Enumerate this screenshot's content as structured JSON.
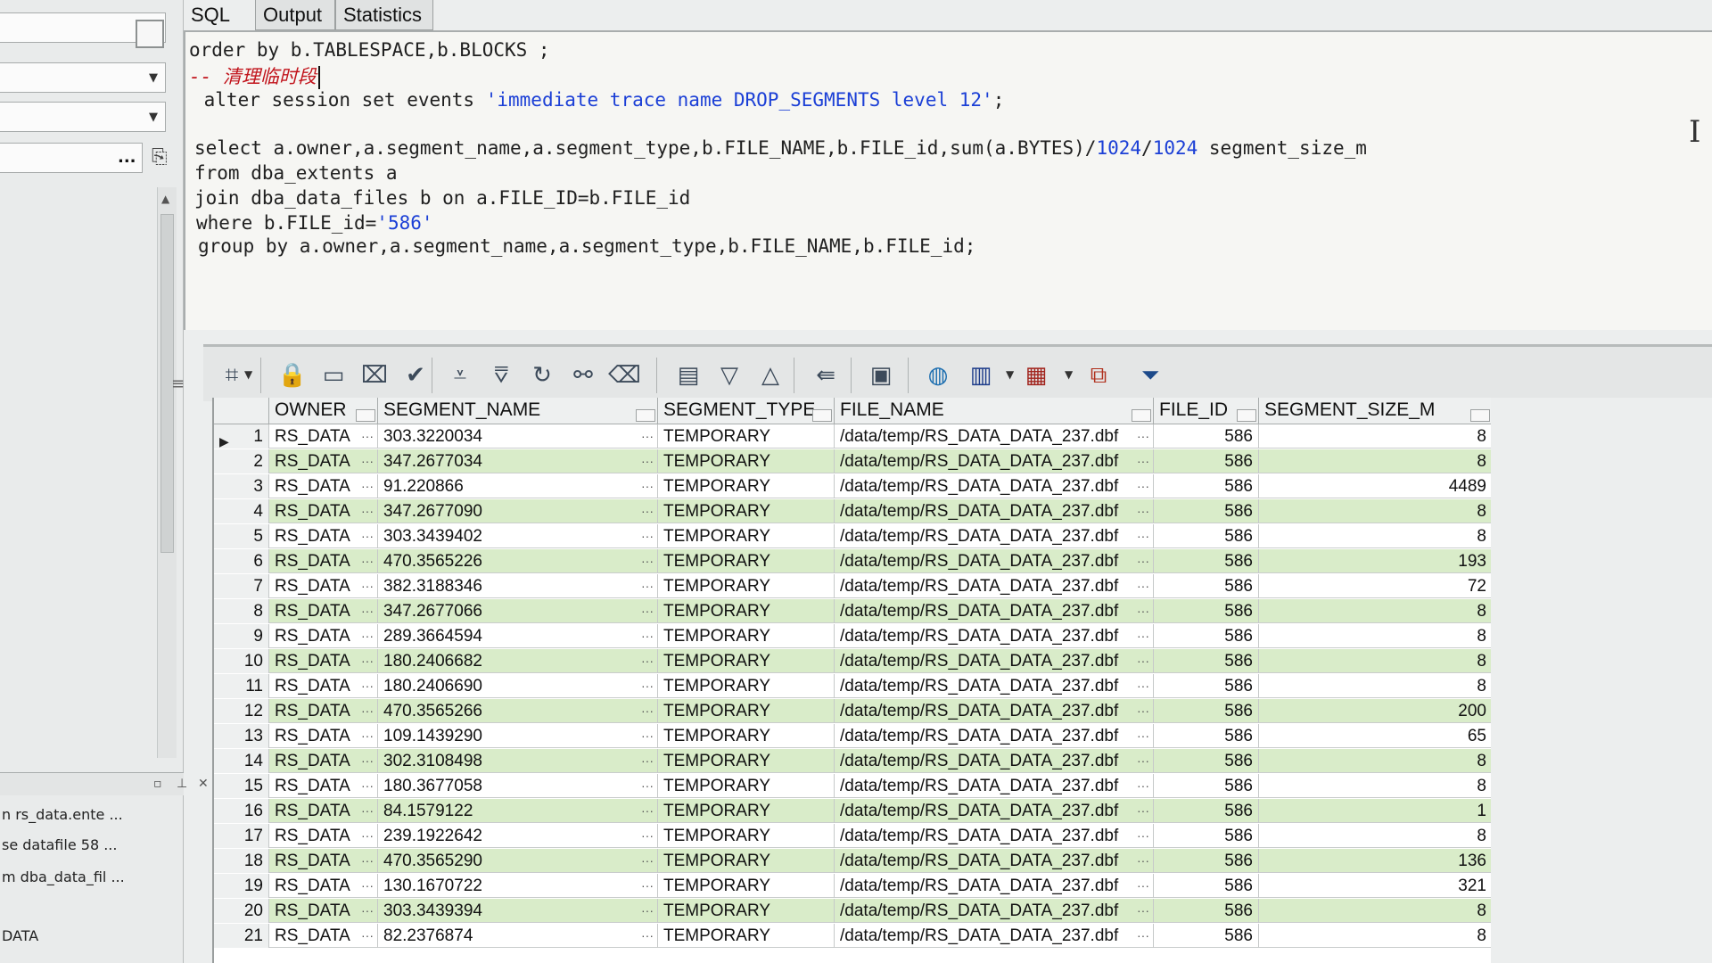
{
  "tabs": [
    {
      "label": "SQL"
    },
    {
      "label": "Output"
    },
    {
      "label": "Statistics"
    }
  ],
  "editor": {
    "lines": [
      [
        {
          "t": "order by b.TABLESPACE,b.BLOCKS ;",
          "c": ""
        }
      ],
      [
        {
          "t": "-- 清理临时段",
          "c": "comment"
        }
      ],
      [
        {
          "t": " alter session set events ",
          "c": ""
        },
        {
          "t": "'immediate trace name DROP_SEGMENTS level 12'",
          "c": "str"
        },
        {
          "t": ";",
          "c": ""
        }
      ],
      [
        {
          "t": "",
          "c": ""
        }
      ],
      [
        {
          "t": "select a.owner,a.segment_name,a.segment_type,b.FILE_NAME,b.FILE_id,sum(a.BYTES)/",
          "c": ""
        },
        {
          "t": "1024",
          "c": "num"
        },
        {
          "t": "/",
          "c": ""
        },
        {
          "t": "1024",
          "c": "num"
        },
        {
          "t": " segment_size_m",
          "c": ""
        }
      ],
      [
        {
          "t": "from dba_extents a",
          "c": ""
        }
      ],
      [
        {
          "t": "join dba_data_files b on a.FILE_ID=b.FILE_id",
          "c": ""
        }
      ],
      [
        {
          "t": "where b.FILE_id=",
          "c": ""
        },
        {
          "t": "'586'",
          "c": "str"
        }
      ],
      [
        {
          "t": "group by a.owner,a.segment_name,a.segment_type,b.FILE_NAME,b.FILE_id;",
          "c": ""
        }
      ]
    ]
  },
  "left_panel": {
    "items": [
      {
        "label": "n rs_data.ente ..."
      },
      {
        "label": "se datafile 58 ..."
      },
      {
        "label": "m dba_data_fil ..."
      },
      {
        "label": "DATA"
      }
    ],
    "ellipsis": "..."
  },
  "toolbar": {
    "icons": [
      "grid-select-icon",
      "lock-icon",
      "new-record-icon",
      "delete-record-icon",
      "post-check-icon",
      "fetch-next-icon",
      "fetch-last-icon",
      "refresh-icon",
      "find-binoculars-icon",
      "clear-eraser-icon",
      "single-record-view-icon",
      "arrow-down-icon",
      "arrow-up-icon",
      "export-query-icon",
      "save-disk-icon",
      "connect-globe-icon",
      "bar-chart-icon",
      "table-grid-icon",
      "compare-icon",
      "filter-funnel-icon"
    ]
  },
  "grid": {
    "columns": [
      {
        "label": ""
      },
      {
        "label": "OWNER"
      },
      {
        "label": "SEGMENT_NAME"
      },
      {
        "label": "SEGMENT_TYPE"
      },
      {
        "label": "FILE_NAME"
      },
      {
        "label": "FILE_ID"
      },
      {
        "label": "SEGMENT_SIZE_M"
      }
    ],
    "more_glyph": "···",
    "current_row_glyph": "▶",
    "rows": [
      {
        "no": "1",
        "owner": "RS_DATA",
        "segment_name": "303.3220034",
        "segment_type": "TEMPORARY",
        "file_name": "/data/temp/RS_DATA_DATA_237.dbf",
        "file_id": "586",
        "size": "8"
      },
      {
        "no": "2",
        "owner": "RS_DATA",
        "segment_name": "347.2677034",
        "segment_type": "TEMPORARY",
        "file_name": "/data/temp/RS_DATA_DATA_237.dbf",
        "file_id": "586",
        "size": "8"
      },
      {
        "no": "3",
        "owner": "RS_DATA",
        "segment_name": "91.220866",
        "segment_type": "TEMPORARY",
        "file_name": "/data/temp/RS_DATA_DATA_237.dbf",
        "file_id": "586",
        "size": "4489"
      },
      {
        "no": "4",
        "owner": "RS_DATA",
        "segment_name": "347.2677090",
        "segment_type": "TEMPORARY",
        "file_name": "/data/temp/RS_DATA_DATA_237.dbf",
        "file_id": "586",
        "size": "8"
      },
      {
        "no": "5",
        "owner": "RS_DATA",
        "segment_name": "303.3439402",
        "segment_type": "TEMPORARY",
        "file_name": "/data/temp/RS_DATA_DATA_237.dbf",
        "file_id": "586",
        "size": "8"
      },
      {
        "no": "6",
        "owner": "RS_DATA",
        "segment_name": "470.3565226",
        "segment_type": "TEMPORARY",
        "file_name": "/data/temp/RS_DATA_DATA_237.dbf",
        "file_id": "586",
        "size": "193"
      },
      {
        "no": "7",
        "owner": "RS_DATA",
        "segment_name": "382.3188346",
        "segment_type": "TEMPORARY",
        "file_name": "/data/temp/RS_DATA_DATA_237.dbf",
        "file_id": "586",
        "size": "72"
      },
      {
        "no": "8",
        "owner": "RS_DATA",
        "segment_name": "347.2677066",
        "segment_type": "TEMPORARY",
        "file_name": "/data/temp/RS_DATA_DATA_237.dbf",
        "file_id": "586",
        "size": "8"
      },
      {
        "no": "9",
        "owner": "RS_DATA",
        "segment_name": "289.3664594",
        "segment_type": "TEMPORARY",
        "file_name": "/data/temp/RS_DATA_DATA_237.dbf",
        "file_id": "586",
        "size": "8"
      },
      {
        "no": "10",
        "owner": "RS_DATA",
        "segment_name": "180.2406682",
        "segment_type": "TEMPORARY",
        "file_name": "/data/temp/RS_DATA_DATA_237.dbf",
        "file_id": "586",
        "size": "8"
      },
      {
        "no": "11",
        "owner": "RS_DATA",
        "segment_name": "180.2406690",
        "segment_type": "TEMPORARY",
        "file_name": "/data/temp/RS_DATA_DATA_237.dbf",
        "file_id": "586",
        "size": "8"
      },
      {
        "no": "12",
        "owner": "RS_DATA",
        "segment_name": "470.3565266",
        "segment_type": "TEMPORARY",
        "file_name": "/data/temp/RS_DATA_DATA_237.dbf",
        "file_id": "586",
        "size": "200"
      },
      {
        "no": "13",
        "owner": "RS_DATA",
        "segment_name": "109.1439290",
        "segment_type": "TEMPORARY",
        "file_name": "/data/temp/RS_DATA_DATA_237.dbf",
        "file_id": "586",
        "size": "65"
      },
      {
        "no": "14",
        "owner": "RS_DATA",
        "segment_name": "302.3108498",
        "segment_type": "TEMPORARY",
        "file_name": "/data/temp/RS_DATA_DATA_237.dbf",
        "file_id": "586",
        "size": "8"
      },
      {
        "no": "15",
        "owner": "RS_DATA",
        "segment_name": "180.3677058",
        "segment_type": "TEMPORARY",
        "file_name": "/data/temp/RS_DATA_DATA_237.dbf",
        "file_id": "586",
        "size": "8"
      },
      {
        "no": "16",
        "owner": "RS_DATA",
        "segment_name": "84.1579122",
        "segment_type": "TEMPORARY",
        "file_name": "/data/temp/RS_DATA_DATA_237.dbf",
        "file_id": "586",
        "size": "1"
      },
      {
        "no": "17",
        "owner": "RS_DATA",
        "segment_name": "239.1922642",
        "segment_type": "TEMPORARY",
        "file_name": "/data/temp/RS_DATA_DATA_237.dbf",
        "file_id": "586",
        "size": "8"
      },
      {
        "no": "18",
        "owner": "RS_DATA",
        "segment_name": "470.3565290",
        "segment_type": "TEMPORARY",
        "file_name": "/data/temp/RS_DATA_DATA_237.dbf",
        "file_id": "586",
        "size": "136"
      },
      {
        "no": "19",
        "owner": "RS_DATA",
        "segment_name": "130.1670722",
        "segment_type": "TEMPORARY",
        "file_name": "/data/temp/RS_DATA_DATA_237.dbf",
        "file_id": "586",
        "size": "321"
      },
      {
        "no": "20",
        "owner": "RS_DATA",
        "segment_name": "303.3439394",
        "segment_type": "TEMPORARY",
        "file_name": "/data/temp/RS_DATA_DATA_237.dbf",
        "file_id": "586",
        "size": "8"
      },
      {
        "no": "21",
        "owner": "RS_DATA",
        "segment_name": "82.2376874",
        "segment_type": "TEMPORARY",
        "file_name": "/data/temp/RS_DATA_DATA_237.dbf",
        "file_id": "586",
        "size": "8"
      }
    ]
  },
  "colors": {
    "row_green": "#d9ecc9",
    "keyword_blue": "#1b3fd6",
    "comment_red": "#c1131b"
  }
}
